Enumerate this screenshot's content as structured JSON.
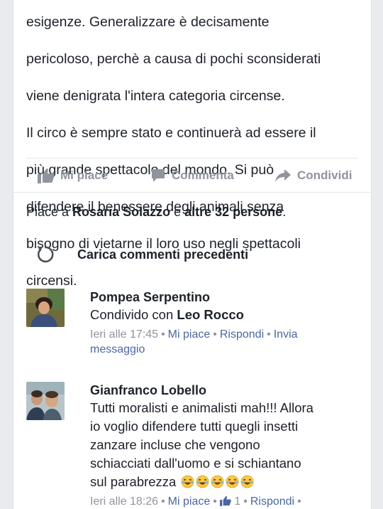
{
  "post": {
    "body_lines": [
      "esigenze. Generalizzare è decisamente",
      "pericoloso, perchè a causa di pochi sconsiderati",
      "viene denigrata l'intera categoria circense.",
      "Il circo è sempre stato e continuerà ad essere il",
      "più grande spettacolo del mondo. Si può",
      "difendere il benessere degli animali senza",
      "bisogno di vietarne il loro uso  negli spettacoli",
      "circensi."
    ]
  },
  "actions": {
    "like_label": "Mi piace",
    "comment_label": "Commenta",
    "share_label": "Condividi"
  },
  "likes_summary": {
    "prefix": "Piace a ",
    "name": "Rosaria Solazzo",
    "middle": " e ",
    "others": "altre 32 persone",
    "suffix": "."
  },
  "load_previous": {
    "label": "Carica commenti precedenti",
    "icon": "refresh-icon"
  },
  "comments": [
    {
      "author": "Pompea Serpentino",
      "text_prefix": "Condivido con ",
      "mention": "Leo Rocco",
      "time": "Ieri alle 17:45",
      "like": "Mi piace",
      "reply": "Rispondi",
      "message_line1": "Invia",
      "message_line2": "messaggio"
    },
    {
      "author": "Gianfranco Lobello",
      "text_lines": [
        "Tutti moralisti e animalisti mah!!! Allora",
        "io voglio difendere tutti quegli insetti",
        "zanzare incluse che vengono",
        "schiacciati dall'uomo e si schiantano",
        "sul parabrezza"
      ],
      "emoji_icon": "laughing-emoji-icon",
      "emoji_count": 5,
      "time": "Ieri alle 18:26",
      "like": "Mi piace",
      "like_count": "1",
      "reply": "Rispondi"
    }
  ],
  "colors": {
    "link": "#4b67a1",
    "muted": "#90949c",
    "text": "#1d2129",
    "background": "#e9ebee"
  }
}
